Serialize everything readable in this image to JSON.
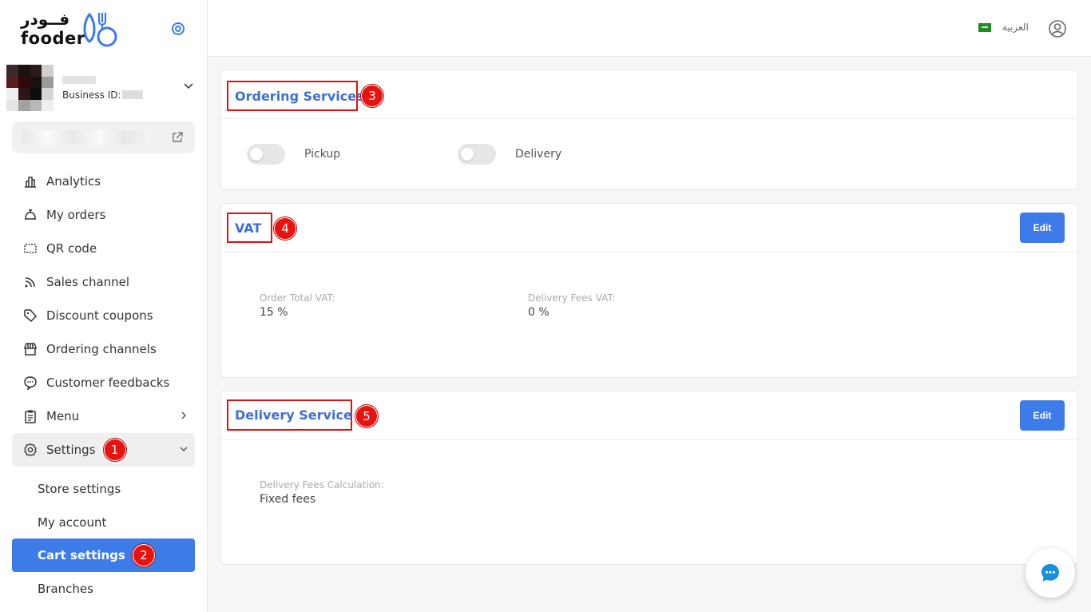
{
  "brand": {
    "name_ar": "فــودر",
    "name_en": "fooder"
  },
  "business": {
    "id_label": "Business ID:"
  },
  "nav": {
    "analytics": "Analytics",
    "orders": "My orders",
    "qr": "QR code",
    "sales": "Sales channel",
    "coupons": "Discount coupons",
    "channels": "Ordering channels",
    "feedbacks": "Customer feedbacks",
    "menu": "Menu",
    "settings": "Settings",
    "store_settings": "Store settings",
    "my_account": "My account",
    "cart_settings": "Cart settings",
    "branches": "Branches"
  },
  "header": {
    "language": "العربية"
  },
  "badges": {
    "b1": "1",
    "b2": "2",
    "b3": "3",
    "b4": "4",
    "b5": "5"
  },
  "ordering": {
    "title": "Ordering Services",
    "pickup": "Pickup",
    "delivery": "Delivery",
    "pickup_on": false,
    "delivery_on": false
  },
  "vat": {
    "title": "VAT",
    "edit": "Edit",
    "order_total_label": "Order Total VAT:",
    "order_total_value": "15 %",
    "delivery_fees_label": "Delivery Fees VAT:",
    "delivery_fees_value": "0 %"
  },
  "delivery_service": {
    "title": "Delivery Service",
    "edit": "Edit",
    "calc_label": "Delivery Fees Calculation:",
    "calc_value": "Fixed fees"
  },
  "colors": {
    "accent": "#3d7be8",
    "annotation": "#e01010",
    "title": "#3d6fd8"
  },
  "icons": {
    "analytics": "bar-chart-icon",
    "orders": "bell-icon",
    "qr": "qr-icon",
    "sales": "rss-icon",
    "coupons": "tag-icon",
    "channels": "store-icon",
    "feedbacks": "chat-icon",
    "menu": "clipboard-icon",
    "settings": "gear-icon"
  }
}
